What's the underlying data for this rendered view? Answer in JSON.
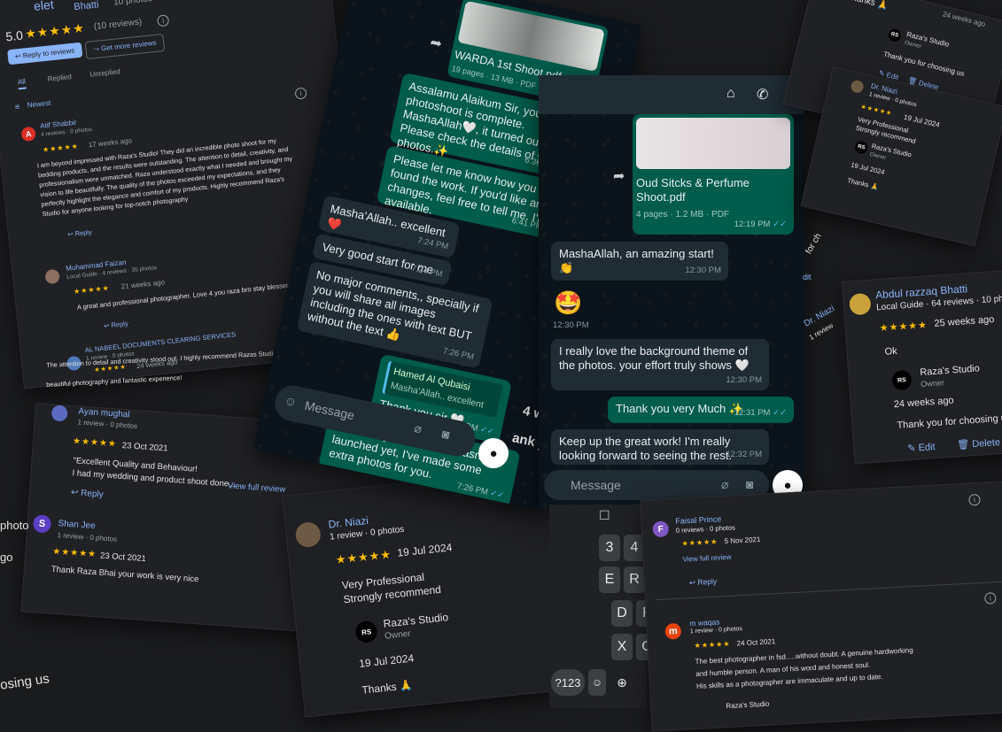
{
  "top_fragment": {
    "partial_name": "Bhatti",
    "photos_frag": "10 photos",
    "delete_frag": "elet"
  },
  "summary": {
    "rating": "5.0",
    "stars": "★★★★★",
    "count": "(10 reviews)",
    "reply_btn": "Reply to reviews",
    "more_btn": "Get more reviews",
    "tabs": [
      "All",
      "Replied",
      "Unreplied"
    ],
    "sort": "Newest"
  },
  "reviews_left": [
    {
      "initial": "A",
      "color": "#d93025",
      "name": "Atif Shabbir",
      "meta": "4 reviews · 0 photos",
      "stars": "★★★★★",
      "time": "17 weeks ago",
      "lines": [
        "I am beyond impressed with Raza's Studio! They did an incredible photo shoot for my",
        "bedding products, and the results were outstanding. The attention to detail, creativity, and",
        "professionalism were unmatched. Raza understood exactly what I needed and brought my",
        "vision to life beautifully. The quality of the photos exceeded my expectations, and they",
        "perfectly highlight the elegance and comfort of my products. Highly recommend Raza's",
        "Studio for anyone looking for top-notch photography"
      ],
      "reply": "Reply"
    },
    {
      "name": "Muhammad Faizan",
      "meta": "Local Guide · 4 reviews · 35 photos",
      "stars": "★★★★★",
      "time": "21 weeks ago",
      "lines": [
        "A great and professional photographer. Love 4 you raza bro stay blessed"
      ],
      "reply": "Reply"
    },
    {
      "name": "AL NABEEL DOCUMENTS CLEARING SERVICES",
      "meta": "1 review · 0 photos",
      "stars": "★★★★★",
      "time": "24 weeks ago",
      "lines": [
        "The attention to detail and creativity stood out. I highly recommend Razas Studio for its",
        "beautiful photography and fantastic experience!"
      ]
    }
  ],
  "reviews_mid": [
    {
      "name": "Ayan mughal",
      "meta": "1 review · 0 photos",
      "stars": "★★★★★",
      "date": "23 Oct 2021",
      "lines": [
        "\"Excellent Quality and Behaviour!",
        "I had my wedding and product shoot done..."
      ],
      "view": "View full review",
      "reply": "Reply"
    },
    {
      "initial": "S",
      "color": "#5b3fc4",
      "name": "Shan Jee",
      "meta": "1 review · 0 photos",
      "stars": "★★★★★",
      "date": "23 Oct 2021",
      "lines": [
        "Thank Raza Bhai your work is very nice"
      ]
    }
  ],
  "niazi_big": {
    "name": "Dr. Niazi",
    "meta": "1 review · 0 photos",
    "stars": "★★★★★",
    "date": "19 Jul 2024",
    "lines": [
      "Very Professional",
      "Strongly recommend"
    ],
    "owner": "Raza's Studio",
    "owner_role": "Owner",
    "owner_date": "19 Jul 2024",
    "owner_reply": "Thanks 🙏"
  },
  "bottom_left": {
    "frag1": "photo",
    "frag2": "go",
    "frag3": "osing us"
  },
  "chat_left": {
    "file": {
      "name": "WARDA 1st Shoot.pdf",
      "meta": "19 pages · 13 MB · PDF"
    },
    "msgs": [
      {
        "text": "Assalamu Alaikum Sir, your photoshoot is complete. MashaAllah🤍, it turned out great. Please check the details of your photos.✨",
        "time": "6:39 PM"
      },
      {
        "text": "Please let me know how you found the work. If you'd like any changes, feel free to tell me. I'm available.",
        "time": "6:41 PM"
      },
      {
        "text": "Masha'Allah.. excellent ❤️",
        "time": "7:24 PM"
      },
      {
        "text": "Very good start for me",
        "time": "7:24 PM"
      },
      {
        "text": "No major comments,, specially if you will share all images including the ones with text BUT without the text 👍",
        "time": "7:26 PM"
      },
      {
        "quote_name": "Hamed Al Qubaisi",
        "quote_text": "Masha'Allah.. excellent",
        "text": "Thank you sir 🤍",
        "time": "7:26 PM"
      },
      {
        "text": "Sir, since your business hasn't launched yet, I've made some extra photos for you.",
        "time": "7:26 PM"
      }
    ],
    "input_placeholder": "Message"
  },
  "chat_right": {
    "file": {
      "name": "Oud Sitcks & Perfume Shoot.pdf",
      "meta": "4 pages · 1.2 MB · PDF",
      "time": "12:19 PM"
    },
    "msgs": [
      {
        "text": "MashaAllah, an amazing start! 👏",
        "time": "12:30 PM"
      },
      {
        "text": "🤩",
        "time": "12:30 PM"
      },
      {
        "text": "I really love the background theme of the photos. your effort truly shows 🤍",
        "time": "12:30 PM"
      },
      {
        "text": "Thank you very Much ✨",
        "time": "12:31 PM"
      },
      {
        "text": "Keep up the great work! I'm really looking forward to seeing the rest.",
        "time": "12:32 PM"
      }
    ],
    "input_placeholder": "Message"
  },
  "keyboard": {
    "keys": [
      "3",
      "4",
      "E",
      "R",
      "D",
      "F",
      "X",
      "C"
    ],
    "mode": "?123"
  },
  "top_right": {
    "thanks": "Thanks 🙏",
    "weeks": "24 weeks ago",
    "owner": "Raza's Studio",
    "owner_role": "Owner",
    "reply": "Thank you for choosing us",
    "edit": "Edit",
    "delete": "Delete"
  },
  "niazi_small": {
    "name": "Dr. Niazi",
    "meta": "1 review · 0 photos",
    "stars": "★★★★★",
    "date": "19 Jul 2024",
    "lines": [
      "Very Professional",
      "Strongly recommend"
    ],
    "owner": "Raza's Studio",
    "owner_role": "Owner",
    "owner_date": "19 Jul 2024",
    "owner_reply": "Thanks 🙏"
  },
  "abdul": {
    "name": "Abdul razzaq Bhatti",
    "meta": "Local Guide · 64 reviews · 10 photos",
    "stars": "★★★★★",
    "time": "25 weeks ago",
    "text": "Ok",
    "owner": "Raza's Studio",
    "owner_role": "Owner",
    "owner_time": "24 weeks ago",
    "reply": "Thank you for choosing us",
    "edit": "Edit",
    "delete": "Delete"
  },
  "reviews_br": [
    {
      "initial": "F",
      "color": "#7e57c2",
      "name": "Faisal Prince",
      "meta": "0 reviews · 0 photos",
      "stars": "★★★★★",
      "date": "5 Nov 2021",
      "view": "View full review",
      "reply": "Reply"
    },
    {
      "initial": "m",
      "color": "#e8430a",
      "name": "m waqas",
      "meta": "1 review · 0 photos",
      "stars": "★★★★★",
      "date": "24 Oct 2021",
      "lines": [
        "The best photographer in fsd.....without doubt. A genuine hardworking",
        "and humble person. A man of his word and honest soul.",
        "His skills as a photographer are immaculate and up to date."
      ],
      "owner": "Raza's Studio"
    }
  ],
  "misc": {
    "frag_dr": "Dr. Niazi",
    "frag_1r": "1 review",
    "frag_it": "dit",
    "frag_for": "for ch",
    "frag_4w": "4 w",
    "frag_ank": "ank y"
  }
}
